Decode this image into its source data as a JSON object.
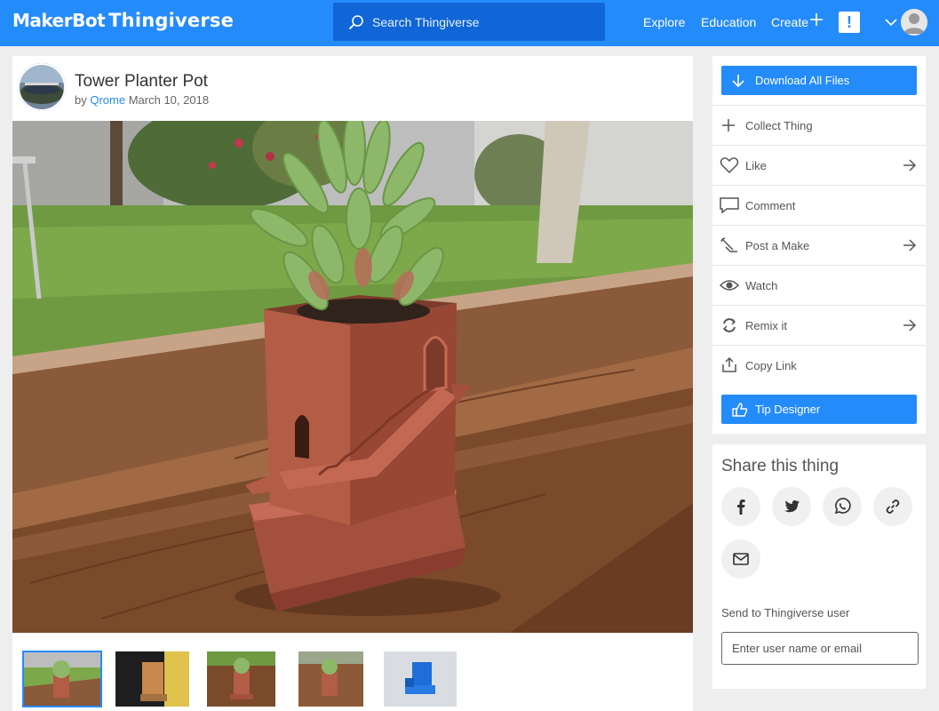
{
  "brand": {
    "maker": "MakerBot",
    "site": "Thingiverse"
  },
  "search": {
    "placeholder": "Search Thingiverse"
  },
  "nav": {
    "explore": "Explore",
    "education": "Education",
    "create": "Create",
    "alert": "!"
  },
  "thing": {
    "title": "Tower Planter Pot",
    "by": "by",
    "author": "Qrome",
    "date": "March 10, 2018"
  },
  "actions": {
    "download": "Download All Files",
    "collect": "Collect Thing",
    "like": "Like",
    "comment": "Comment",
    "post_make": "Post a Make",
    "watch": "Watch",
    "remix": "Remix it",
    "copy_link": "Copy Link",
    "tip": "Tip Designer"
  },
  "share": {
    "title": "Share this thing",
    "send_label": "Send to Thingiverse user",
    "send_placeholder": "Enter user name or email"
  },
  "icons": [
    "search-icon",
    "plus-icon",
    "chevron-down-icon",
    "download-icon",
    "like-icon",
    "comment-icon",
    "post-make-icon",
    "watch-icon",
    "remix-icon",
    "copy-link-icon",
    "tip-icon",
    "facebook-icon",
    "twitter-icon",
    "whatsapp-icon",
    "link-icon",
    "email-icon",
    "arrow-right-icon"
  ],
  "colors": {
    "brand_blue": "#248bfb",
    "search_bg": "#1066d6",
    "page_bg": "#eeeeee"
  }
}
